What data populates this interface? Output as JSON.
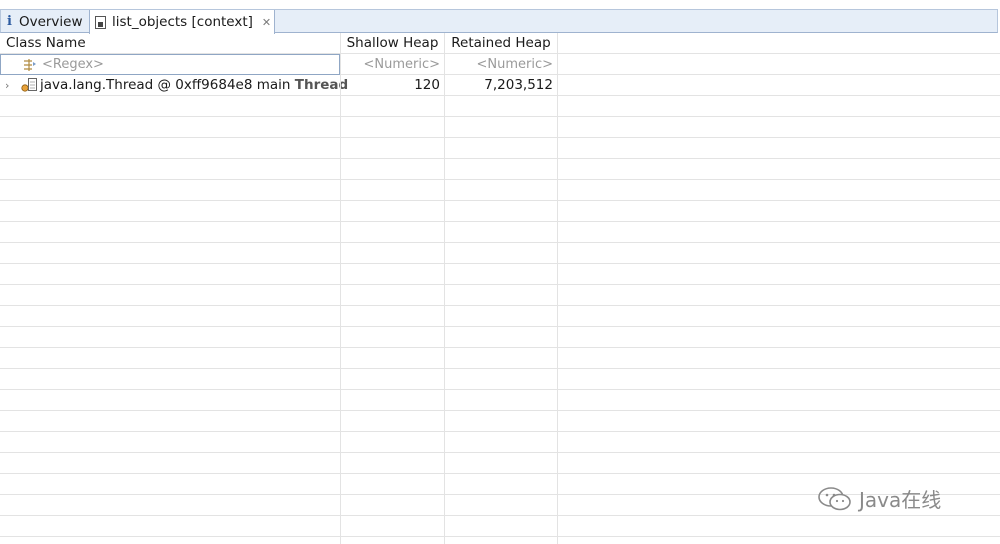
{
  "tabs": [
    {
      "label": "Overview",
      "icon": "info-icon"
    },
    {
      "label": "list_objects [context]",
      "icon": "document-icon",
      "close_icon": "close-icon"
    }
  ],
  "table": {
    "columns": [
      "Class Name",
      "Shallow Heap",
      "Retained Heap"
    ],
    "filters": [
      "<Regex>",
      "<Numeric>",
      "<Numeric>"
    ],
    "rows": [
      {
        "class_name": "java.lang.Thread @ 0xff9684e8  main",
        "suffix": "Thread",
        "shallow_heap": "120",
        "retained_heap": "7,203,512",
        "icon": "thread-object-icon",
        "expand_icon": "chevron-right-icon"
      }
    ]
  },
  "watermark": {
    "text": "Java在线",
    "icon": "wechat-icon"
  },
  "colors": {
    "tab_bar": "#e6eef8",
    "grid_line": "#e3e3e3",
    "filter_text": "#9a9a9a"
  }
}
